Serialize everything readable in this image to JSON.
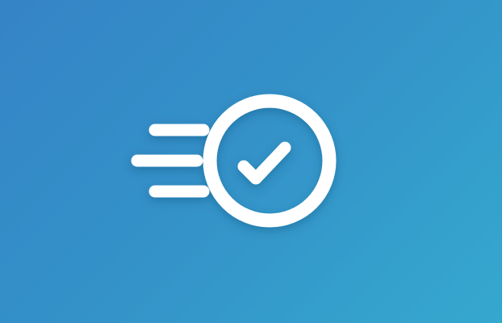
{
  "background": {
    "gradient_start": "#3584c6",
    "gradient_mid": "#3491c8",
    "gradient_end": "#35a8cf"
  },
  "icon": {
    "name": "fast-check-icon",
    "color": "#ffffff"
  }
}
